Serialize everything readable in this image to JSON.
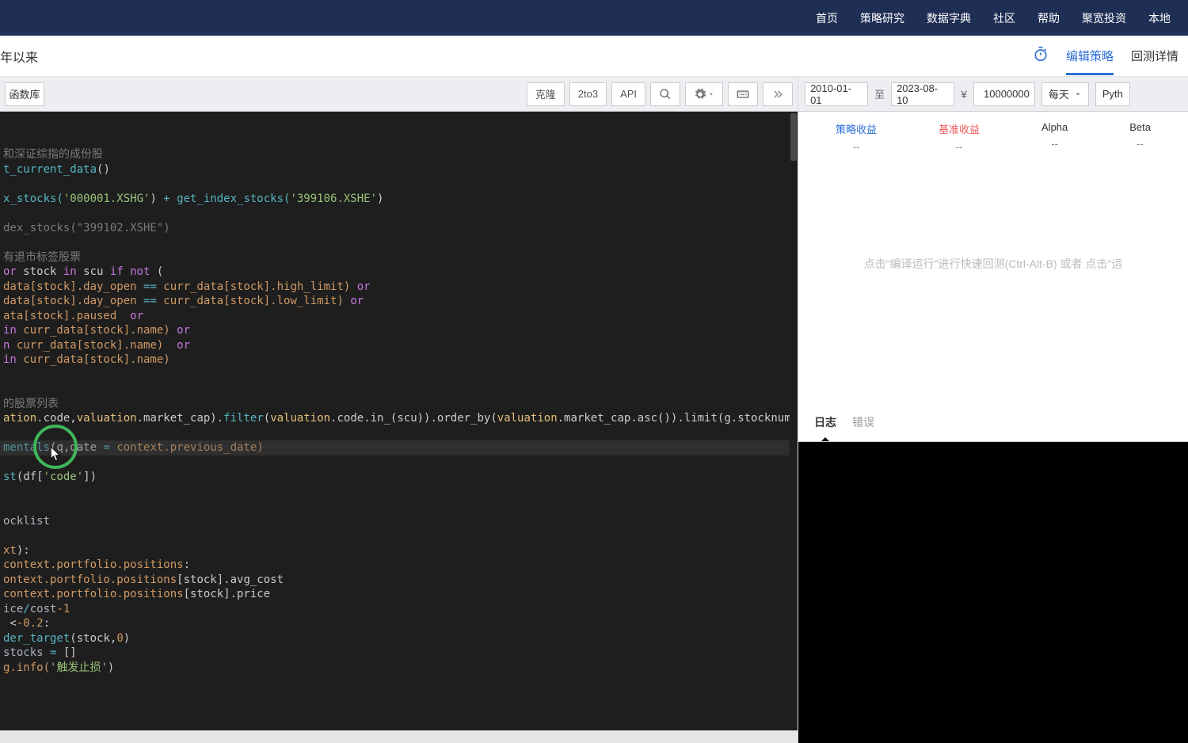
{
  "nav": {
    "home": "首页",
    "strategy": "策略研究",
    "data_dict": "数据字典",
    "community": "社区",
    "help": "帮助",
    "invest": "聚宽投资",
    "local": "本地"
  },
  "header": {
    "title": "年以来",
    "edit_strategy": "编辑策略",
    "backtest_detail": "回测详情"
  },
  "toolbar": {
    "fn_lib": "函数库",
    "clone": "克隆",
    "twoto3": "2to3",
    "api": "API"
  },
  "params": {
    "start_date": "2010-01-01",
    "to": "至",
    "end_date": "2023-08-10",
    "currency": "¥",
    "amount": "10000000",
    "freq": "每天",
    "lang": "Pyth"
  },
  "metrics": {
    "strategy_return": "策略收益",
    "benchmark_return": "基准收益",
    "alpha": "Alpha",
    "beta": "Beta",
    "placeholder": "--"
  },
  "hint": "点击\"编译运行\"进行快速回测(Ctrl-Alt-B) 或者 点击\"运",
  "logs": {
    "tab_log": "日志",
    "tab_error": "错误"
  },
  "code": {
    "l1": "和深证综指的成份股",
    "l2a": "t_current_data",
    "l2b": "()",
    "l3a": "x_stocks(",
    "l3b": "'000001.XSHG'",
    "l3c": ") ",
    "l3d": "+",
    "l3e": " get_index_stocks(",
    "l3f": "'399106.XSHE'",
    "l3g": ")",
    "l4": "dex_stocks(\"399102.XSHE\")",
    "l5": "有退市标签股票",
    "l6a": "or",
    "l6b": " stock ",
    "l6c": "in",
    "l6d": " scu ",
    "l6e": "if",
    "l6f": " ",
    "l6g": "not",
    "l6h": " (",
    "l7a": "data[stock].day_open ",
    "l7b": "==",
    "l7c": " curr_data[stock].high_limit) ",
    "l7d": "or",
    "l8a": "data[stock].day_open ",
    "l8b": "==",
    "l8c": " curr_data[stock].low_limit) ",
    "l8d": "or",
    "l9a": "ata[stock].paused  ",
    "l9b": "or",
    "l10a": "in",
    "l10b": " curr_data[stock].name) ",
    "l10c": "or",
    "l11a": "n",
    "l11b": " curr_data[stock].name)  ",
    "l11c": "or",
    "l12a": "in",
    "l12b": " curr_data[stock].name)",
    "l13": "的股票列表",
    "l14a": "ation",
    "l14b": ".code,",
    "l14c": "valuation",
    "l14d": ".market_cap).",
    "l14e": "filter",
    "l14f": "(",
    "l14g": "valuation",
    "l14h": ".code.in_(scu)).order_by(",
    "l14i": "valuation",
    "l14j": ".market_cap.asc()).limit(g.stocknum)",
    "l15a": "mentals",
    "l15b": "(q,date ",
    "l15c": "=",
    "l15d": " context.previous_date)",
    "l16a": "st",
    "l16b": "(df[",
    "l16c": "'code'",
    "l16d": "])",
    "l17": "ocklist",
    "l18a": "xt",
    "l18b": "):",
    "l19a": "context.portfolio.positions",
    "l19b": ":",
    "l20a": "ontext.portfolio.positions",
    "l20b": "[stock].avg_cost",
    "l21a": "context.portfolio.positions",
    "l21b": "[stock].price",
    "l22a": "ice",
    "l22b": "/",
    "l22c": "cost",
    "l22d": "-1",
    "l23a": " <",
    "l23b": "-0.2",
    "l23c": ":",
    "l24a": "der_target",
    "l24b": "(stock,",
    "l24c": "0",
    "l24d": ")",
    "l25a": "stocks ",
    "l25b": "=",
    "l25c": " []",
    "l26a": "g.info(",
    "l26b": "'触发止损'",
    "l26c": ")"
  }
}
